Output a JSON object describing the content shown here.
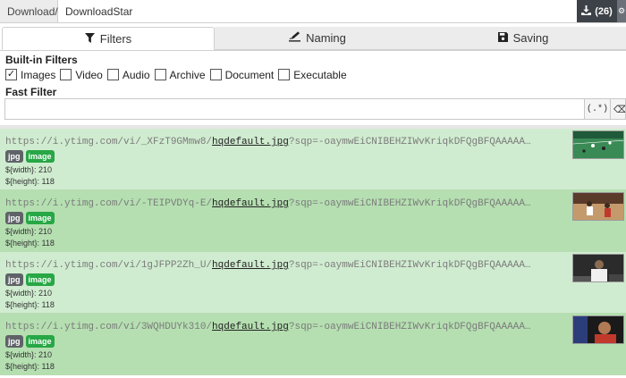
{
  "pathbar": {
    "prefix": "Download/",
    "value": "DownloadStar",
    "download_count": "(26)"
  },
  "tabs": [
    {
      "label": "Filters",
      "icon": "filter-icon",
      "active": true
    },
    {
      "label": "Naming",
      "icon": "signature-icon",
      "active": false
    },
    {
      "label": "Saving",
      "icon": "floppy-disk-icon",
      "active": false
    }
  ],
  "builtin_filters": {
    "title": "Built-in Filters",
    "items": [
      {
        "label": "Images",
        "checked": true
      },
      {
        "label": "Video",
        "checked": false
      },
      {
        "label": "Audio",
        "checked": false
      },
      {
        "label": "Archive",
        "checked": false
      },
      {
        "label": "Document",
        "checked": false
      },
      {
        "label": "Executable",
        "checked": false
      }
    ]
  },
  "fast_filter": {
    "title": "Fast Filter",
    "value": "",
    "placeholder": "",
    "regex_label": "(.*)"
  },
  "colors": {
    "row_light": "#d0ecd0",
    "row_dark": "#b5dfb1",
    "badge_ext": "#5f6368",
    "badge_type": "#27a745",
    "download_button": "#3d4148"
  },
  "results": [
    {
      "url_prefix": "https://i.ytimg.com/vi/_XFzT9GMmw8/",
      "filename": "hqdefault.jpg",
      "url_suffix": "?sqp=-oaymwEiCNIBEHZIWvKriqkDFQgBFQAAAAA…",
      "ext": "jpg",
      "type": "image",
      "width": "${width}: 210",
      "height": "${height}: 118"
    },
    {
      "url_prefix": "https://i.ytimg.com/vi/-TEIPVDYq-E/",
      "filename": "hqdefault.jpg",
      "url_suffix": "?sqp=-oaymwEiCNIBEHZIWvKriqkDFQgBFQAAAAA…",
      "ext": "jpg",
      "type": "image",
      "width": "${width}: 210",
      "height": "${height}: 118"
    },
    {
      "url_prefix": "https://i.ytimg.com/vi/1gJFPP2Zh_U/",
      "filename": "hqdefault.jpg",
      "url_suffix": "?sqp=-oaymwEiCNIBEHZIWvKriqkDFQgBFQAAAAA…",
      "ext": "jpg",
      "type": "image",
      "width": "${width}: 210",
      "height": "${height}: 118"
    },
    {
      "url_prefix": "https://i.ytimg.com/vi/3WQHDUYk310/",
      "filename": "hqdefault.jpg",
      "url_suffix": "?sqp=-oaymwEiCNIBEHZIWvKriqkDFQgBFQAAAAA…",
      "ext": "jpg",
      "type": "image",
      "width": "${width}: 210",
      "height": "${height}: 118"
    }
  ]
}
